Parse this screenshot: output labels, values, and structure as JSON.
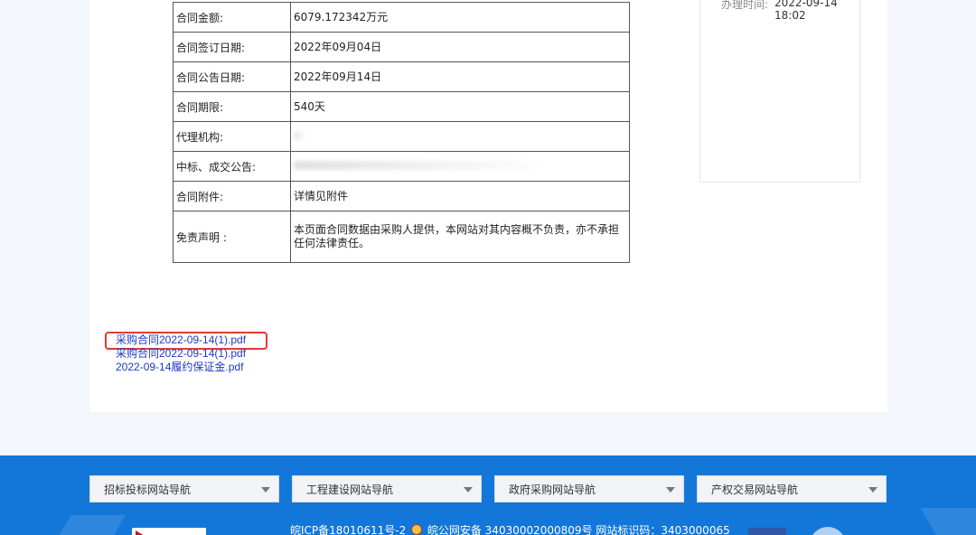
{
  "table": {
    "rows": [
      {
        "label": "合同金额:",
        "value": "6079.172342万元"
      },
      {
        "label": "合同签订日期:",
        "value": "2022年09月04日"
      },
      {
        "label": "合同公告日期:",
        "value": "2022年09月14日"
      },
      {
        "label": "合同期限:",
        "value": "540天"
      },
      {
        "label": "代理机构:",
        "value": ""
      },
      {
        "label": "中标、成交公告:",
        "value": ""
      },
      {
        "label": "合同附件:",
        "value": "详情见附件"
      },
      {
        "label": "免责声明 :",
        "value": "本页面合同数据由采购人提供，本网站对其内容概不负责，亦不承担任何法律责任。"
      }
    ]
  },
  "side": {
    "handle_time_label": "办理时间:",
    "handle_time_value": "2022-09-14 18:02"
  },
  "attachments": [
    "采购合同2022-09-14(1).pdf",
    "采购合同2022-09-14(1).pdf",
    "2022-09-14履约保证金.pdf"
  ],
  "footer": {
    "nav": [
      "招标投标网站导航",
      "工程建设网站导航",
      "政府采购网站导航",
      "产权交易网站导航"
    ],
    "icp_text": "皖ICP备18010611号-2",
    "security_text": "皖公网安备 34030002000809号 网站标识码：3403000065"
  },
  "colors": {
    "footer_bg": "#1377d9",
    "link": "#1d39c4",
    "highlight": "#e53935"
  }
}
